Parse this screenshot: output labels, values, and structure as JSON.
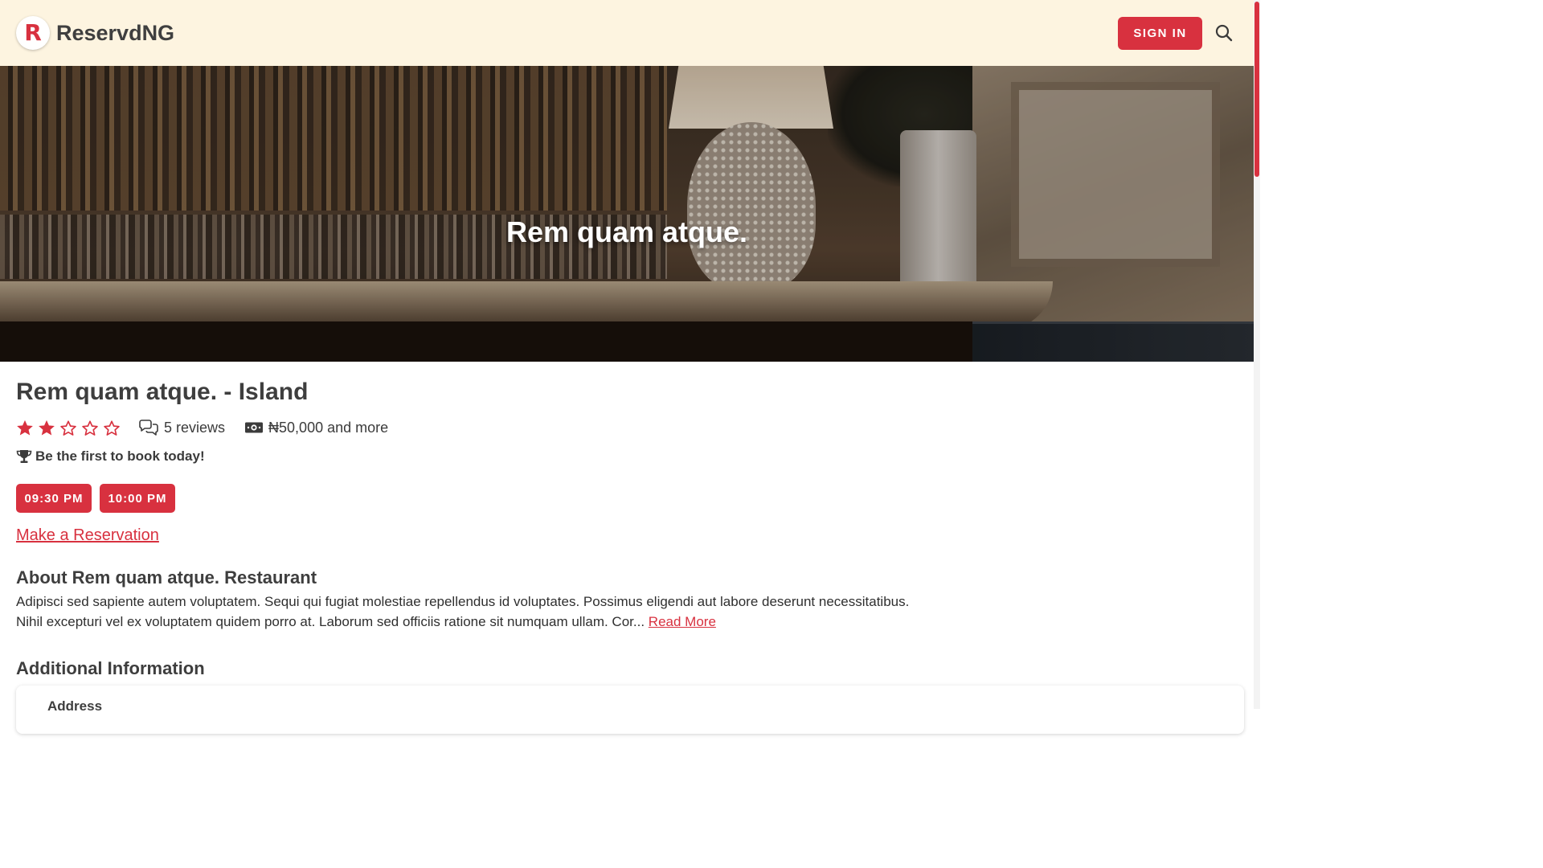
{
  "header": {
    "logo_letter": "R",
    "brand": "ReservdNG",
    "sign_in_label": "SIGN IN",
    "search_icon": "search-icon"
  },
  "hero": {
    "title": "Rem quam atque."
  },
  "restaurant": {
    "title": "Rem quam atque. - Island",
    "rating": 2,
    "rating_max": 5,
    "reviews_label": "5 reviews",
    "price_label": "₦50,000 and more",
    "first_book_label": "Be the first to book today!",
    "times": [
      "09:30 PM",
      "10:00 PM"
    ],
    "reserve_link": "Make a Reservation"
  },
  "about": {
    "title": "About Rem quam atque. Restaurant",
    "line1": "Adipisci sed sapiente autem voluptatem. Sequi qui fugiat molestiae repellendus id voluptates. Possimus eligendi aut labore deserunt necessitatibus.",
    "line2": "Nihil excepturi vel ex voluptatem quidem porro at. Laborum sed officiis ratione sit numquam ullam. Cor...",
    "read_more": "Read More"
  },
  "additional": {
    "title": "Additional Information",
    "address_label": "Address"
  },
  "colors": {
    "accent": "#d8313f",
    "header_bg": "#fdf4e0",
    "text": "#3b3b3b"
  }
}
